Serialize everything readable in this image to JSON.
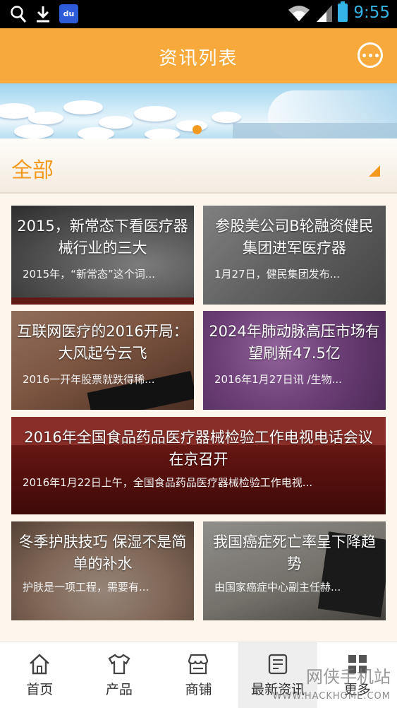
{
  "status_bar": {
    "time": "9:55",
    "baidu_label": "du"
  },
  "header": {
    "title": "资讯列表"
  },
  "category": {
    "label": "全部"
  },
  "news": [
    {
      "title": "2015，新常态下看医疗器械行业的三大",
      "desc": "2015年，“新常态”这个词..."
    },
    {
      "title": "参股美公司B轮融资健民集团进军医疗器",
      "desc": "1月27日，健民集团发布..."
    },
    {
      "title": "互联网医疗的2016开局：大风起兮云飞",
      "desc": "2016一开年股票就跌得稀..."
    },
    {
      "title": "2024年肺动脉高压市场有望刷新47.5亿",
      "desc": "2016年1月27日讯 /生物..."
    },
    {
      "title": "2016年全国食品药品医疗器械检验工作电视电话会议在京召开",
      "desc": "2016年1月22日上午，全国食品药品医疗器械检验工作电视..."
    },
    {
      "title": "冬季护肤技巧 保湿不是简单的补水",
      "desc": "护肤是一项工程，需要有..."
    },
    {
      "title": "我国癌症死亡率呈下降趋势",
      "desc": "由国家癌症中心副主任赫..."
    }
  ],
  "bottom_nav": [
    {
      "label": "首页",
      "icon": "home-icon"
    },
    {
      "label": "产品",
      "icon": "shirt-icon"
    },
    {
      "label": "商铺",
      "icon": "shop-icon"
    },
    {
      "label": "最新资讯",
      "icon": "news-icon",
      "active": true
    },
    {
      "label": "更多",
      "icon": "grid-icon"
    }
  ],
  "watermark": {
    "name": "网侠手机站",
    "url": "WWW.HACKHOME.COM"
  },
  "colors": {
    "accent": "#f7a93b",
    "accent_text": "#f39a1e",
    "status_time": "#35b4e6"
  }
}
